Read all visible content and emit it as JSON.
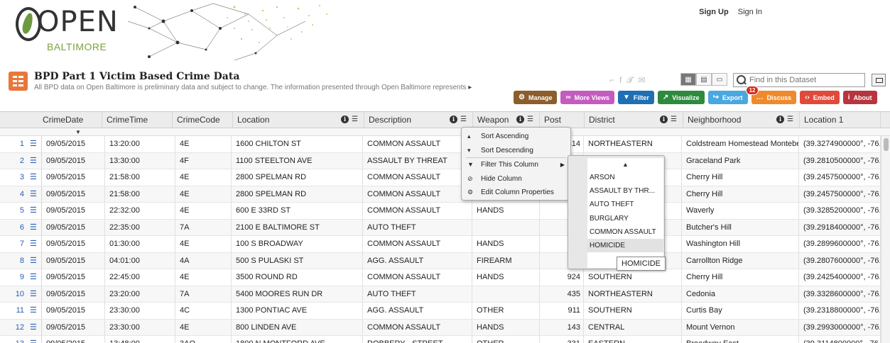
{
  "header": {
    "logo_text": "OPEN",
    "logo_sub": "BALTIMORE",
    "sign_up": "Sign Up",
    "sign_in": "Sign In"
  },
  "dataset": {
    "title": "BPD Part 1 Victim Based Crime Data",
    "description": "All BPD data on Open Baltimore is preliminary data and subject to change. The information presented through Open Baltimore represents",
    "search_placeholder": "Find in this Dataset"
  },
  "actions": [
    {
      "label": "Manage",
      "icon": "gear-icon",
      "color": "#8b5e2b"
    },
    {
      "label": "More Views",
      "icon": "binoculars-icon",
      "color": "#c45cbf"
    },
    {
      "label": "Filter",
      "icon": "filter-icon",
      "color": "#1f6fb5"
    },
    {
      "label": "Visualize",
      "icon": "chart-icon",
      "color": "#2e8a3f"
    },
    {
      "label": "Export",
      "icon": "export-icon",
      "color": "#4aa8e0"
    },
    {
      "label": "Discuss",
      "icon": "chat-icon",
      "color": "#ef8a2c",
      "badge": "12"
    },
    {
      "label": "Embed",
      "icon": "code-icon",
      "color": "#e04a3b"
    },
    {
      "label": "About",
      "icon": "info-icon",
      "color": "#b8343e"
    }
  ],
  "columns": [
    "CrimeDate",
    "CrimeTime",
    "CrimeCode",
    "Location",
    "Description",
    "Weapon",
    "Post",
    "District",
    "Neighborhood",
    "Location 1"
  ],
  "rows": [
    {
      "n": "1",
      "date": "09/05/2015",
      "time": "13:20:00",
      "code": "4E",
      "loc": "1600 CHILTON ST",
      "desc": "COMMON ASSAULT",
      "weapon": "",
      "post": "414",
      "district": "NORTHEASTERN",
      "nbhd": "Coldstream Homestead Montebel",
      "loc1": "(39.3274900000°, -76."
    },
    {
      "n": "2",
      "date": "09/05/2015",
      "time": "13:30:00",
      "code": "4F",
      "loc": "1100 STEELTON AVE",
      "desc": "ASSAULT BY THREAT",
      "weapon": "",
      "post": "",
      "district": "",
      "nbhd": "Graceland Park",
      "loc1": "(39.2810500000°, -76."
    },
    {
      "n": "3",
      "date": "09/05/2015",
      "time": "21:58:00",
      "code": "4E",
      "loc": "2800 SPELMAN RD",
      "desc": "COMMON ASSAULT",
      "weapon": "",
      "post": "",
      "district": "",
      "nbhd": "Cherry Hill",
      "loc1": "(39.2457500000°, -76."
    },
    {
      "n": "4",
      "date": "09/05/2015",
      "time": "21:58:00",
      "code": "4E",
      "loc": "2800 SPELMAN RD",
      "desc": "COMMON ASSAULT",
      "weapon": "",
      "post": "",
      "district": "",
      "nbhd": "Cherry Hill",
      "loc1": "(39.2457500000°, -76."
    },
    {
      "n": "5",
      "date": "09/05/2015",
      "time": "22:32:00",
      "code": "4E",
      "loc": "600 E 33RD ST",
      "desc": "COMMON ASSAULT",
      "weapon": "HANDS",
      "post": "",
      "district": "",
      "nbhd": "Waverly",
      "loc1": "(39.3285200000°, -76."
    },
    {
      "n": "6",
      "date": "09/05/2015",
      "time": "22:35:00",
      "code": "7A",
      "loc": "2100 E BALTIMORE ST",
      "desc": "AUTO THEFT",
      "weapon": "",
      "post": "",
      "district": "",
      "nbhd": "Butcher's Hill",
      "loc1": "(39.2918400000°, -76."
    },
    {
      "n": "7",
      "date": "09/05/2015",
      "time": "01:30:00",
      "code": "4E",
      "loc": "100 S BROADWAY",
      "desc": "COMMON ASSAULT",
      "weapon": "HANDS",
      "post": "",
      "district": "",
      "nbhd": "Washington Hill",
      "loc1": "(39.2899600000°, -76."
    },
    {
      "n": "8",
      "date": "09/05/2015",
      "time": "04:01:00",
      "code": "4A",
      "loc": "500 S PULASKI ST",
      "desc": "AGG. ASSAULT",
      "weapon": "FIREARM",
      "post": "",
      "district": "",
      "nbhd": "Carrollton Ridge",
      "loc1": "(39.2807600000°, -76."
    },
    {
      "n": "9",
      "date": "09/05/2015",
      "time": "22:45:00",
      "code": "4E",
      "loc": "3500 ROUND RD",
      "desc": "COMMON ASSAULT",
      "weapon": "HANDS",
      "post": "924",
      "district": "SOUTHERN",
      "nbhd": "Cherry Hill",
      "loc1": "(39.2425400000°, -76."
    },
    {
      "n": "10",
      "date": "09/05/2015",
      "time": "23:20:00",
      "code": "7A",
      "loc": "5400 MOORES RUN DR",
      "desc": "AUTO THEFT",
      "weapon": "",
      "post": "435",
      "district": "NORTHEASTERN",
      "nbhd": "Cedonia",
      "loc1": "(39.3328600000°, -76."
    },
    {
      "n": "11",
      "date": "09/05/2015",
      "time": "23:30:00",
      "code": "4C",
      "loc": "1300 PONTIAC AVE",
      "desc": "AGG. ASSAULT",
      "weapon": "OTHER",
      "post": "911",
      "district": "SOUTHERN",
      "nbhd": "Curtis Bay",
      "loc1": "(39.2318800000°, -76."
    },
    {
      "n": "12",
      "date": "09/05/2015",
      "time": "23:30:00",
      "code": "4E",
      "loc": "800 LINDEN AVE",
      "desc": "COMMON ASSAULT",
      "weapon": "HANDS",
      "post": "143",
      "district": "CENTRAL",
      "nbhd": "Mount Vernon",
      "loc1": "(39.2993000000°, -76."
    },
    {
      "n": "13",
      "date": "09/05/2015",
      "time": "13:48:00",
      "code": "3AO",
      "loc": "1800 N MONTFORD AVE",
      "desc": "ROBBERY - STREET",
      "weapon": "OTHER",
      "post": "331",
      "district": "EASTERN",
      "nbhd": "Broadway East",
      "loc1": "(39.3114800000°, -76."
    }
  ],
  "column_menu": {
    "sort_asc": "Sort Ascending",
    "sort_desc": "Sort Descending",
    "filter": "Filter This Column",
    "hide": "Hide Column",
    "edit": "Edit Column Properties"
  },
  "filter_values": [
    "ARSON",
    "ASSAULT BY THR...",
    "AUTO THEFT",
    "BURGLARY",
    "COMMON ASSAULT",
    "HOMICIDE"
  ],
  "filter_tooltip": "HOMICIDE"
}
